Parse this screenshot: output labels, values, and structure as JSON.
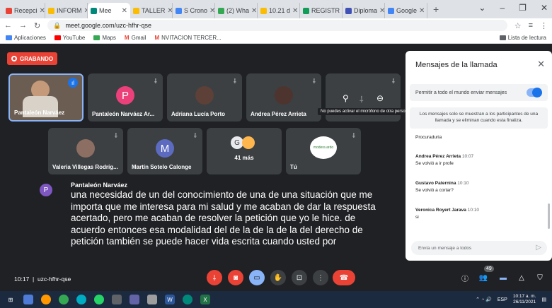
{
  "tabs": [
    {
      "label": "Recepci",
      "color": "#ea4335",
      "active": false
    },
    {
      "label": "INFORM",
      "color": "#fbbc04",
      "active": false
    },
    {
      "label": "Mee",
      "color": "#00897b",
      "active": true
    },
    {
      "label": "TALLER",
      "color": "#fbbc04",
      "active": false
    },
    {
      "label": "S Crono",
      "color": "#4285f4",
      "active": false
    },
    {
      "label": "(2) Wha",
      "color": "#34a853",
      "active": false
    },
    {
      "label": "10.21 d",
      "color": "#fbbc04",
      "active": false
    },
    {
      "label": "REGISTR",
      "color": "#0f9d58",
      "active": false
    },
    {
      "label": "Diploma",
      "color": "#3f51b5",
      "active": false
    },
    {
      "label": "Google",
      "color": "#4285f4",
      "active": false
    }
  ],
  "url": "meet.google.com/uzc-hfhr-qse",
  "bookmarks": [
    "Aplicaciones",
    "YouTube",
    "Maps",
    "Gmail",
    "NVITACION TERCER..."
  ],
  "reading_list": "Lista de lectura",
  "recording_label": "GRABANDO",
  "participants": [
    {
      "name": "Pantaleón Narváez"
    },
    {
      "name": "Pantaleón Narváez Ar...",
      "initial": "P"
    },
    {
      "name": "Adriana Lucía Porto"
    },
    {
      "name": "Andrea Pérez Arrieta"
    },
    {
      "name": "Valeria Villegas Rodríg..."
    },
    {
      "name": "Martín Sotelo Calonge",
      "initial": "M"
    },
    {
      "name": "41 más",
      "initial": "G"
    },
    {
      "name": "Tú",
      "logo_text": "modera ardo"
    }
  ],
  "tooltip": "No puedes activar el micrófono de otra persona",
  "caption": {
    "speaker": "Pantaleón Narváez",
    "initial": "P",
    "text": "una necesidad de un del conocimiento de una de una situación que me importa que me interesa para mi salud y me acaban de dar la respuesta acertado, pero me acaban de resolver la petición que yo le hice. de acuerdo entonces esa modalidad del de la de la de la del derecho de petición también se puede hacer vida escrita cuando usted por"
  },
  "chat": {
    "title": "Mensajes de la llamada",
    "permission": "Permitir a todo el mundo enviar mensajes",
    "info": "Los mensajes solo se muestran a los participantes de una llamada y se eliminan cuando esta finaliza.",
    "first": "Procuraduria",
    "messages": [
      {
        "sender": "Andrea Pérez Arrieta",
        "time": "10:07",
        "text": "Se volvió a ir profe"
      },
      {
        "sender": "Gustavo Paternina",
        "time": "10:10",
        "text": "Se volvió a cortar?"
      },
      {
        "sender": "Veronica Royert Jarava",
        "time": "10:10",
        "text": "si"
      }
    ],
    "placeholder": "Envía un mensaje a todos"
  },
  "meeting": {
    "time": "10:17",
    "code": "uzc-hfhr-qse",
    "participant_count": "49"
  },
  "taskbar": {
    "time": "10:17 a. m.",
    "date": "26/11/2021",
    "lang": "ESP"
  }
}
